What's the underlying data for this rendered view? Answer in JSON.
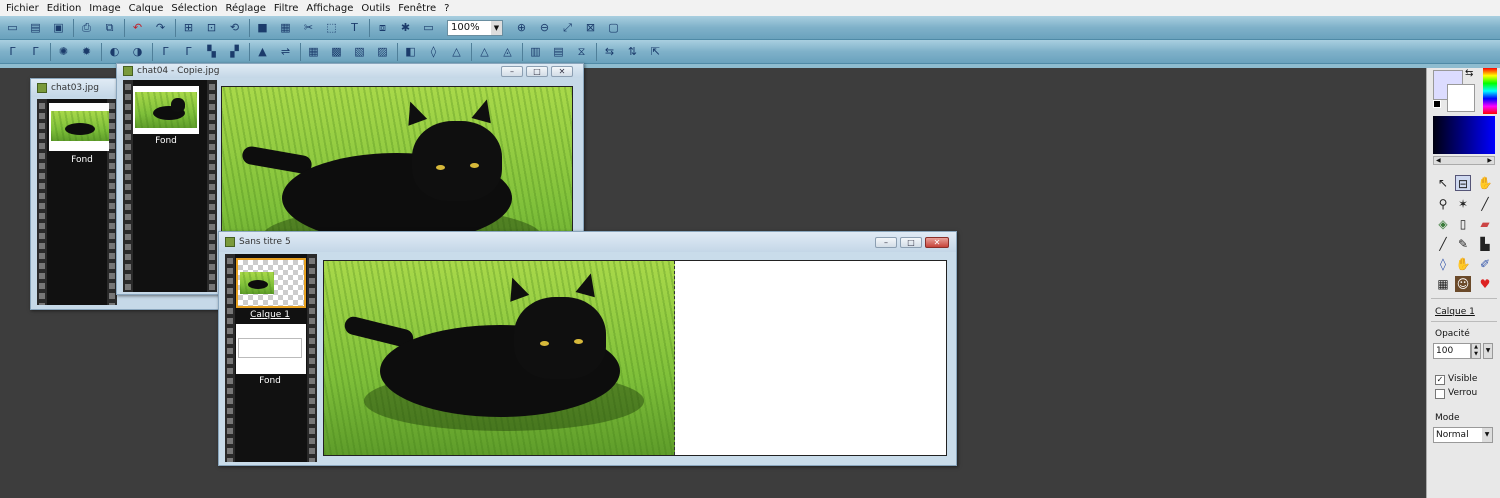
{
  "menu": [
    "Fichier",
    "Edition",
    "Image",
    "Calque",
    "Sélection",
    "Réglage",
    "Filtre",
    "Affichage",
    "Outils",
    "Fenêtre",
    "?"
  ],
  "toolbar": {
    "zoom_value": "100%",
    "row1_icons": [
      "new-icon",
      "open-icon",
      "save-icon",
      "print-icon",
      "scan-icon",
      "undo-icon",
      "redo-icon",
      "crop-icon",
      "resize-icon",
      "rotate-icon",
      "canvas-icon",
      "effect-icon",
      "cut-icon",
      "select-icon",
      "text-icon",
      "layer-icon",
      "stamp-icon",
      "frame-icon"
    ],
    "row2_icons": [
      "auto-level-icon",
      "auto-contrast-icon",
      "brightness-icon",
      "contrast-icon",
      "levels-icon",
      "curves-icon",
      "gamma-icon",
      "gamma2-icon",
      "rgb-icon",
      "hue-icon",
      "histogram-icon",
      "balance-icon",
      "sharpen-icon",
      "blur-icon",
      "smooth-icon",
      "noise-icon",
      "drop-icon",
      "drop2-icon",
      "triangle-icon",
      "triangle2-icon",
      "palette-icon",
      "monitor-icon",
      "grid-icon",
      "clip-icon",
      "flip-icon",
      "mirror-icon",
      "export-icon"
    ]
  },
  "windows": {
    "back": {
      "title": "chat03.jpg",
      "layer_label": "Fond"
    },
    "middle": {
      "title": "chat04 - Copie.jpg",
      "layer_label": "Fond"
    },
    "front": {
      "title": "Sans titre 5",
      "layer1_label": "Calque 1",
      "layer2_label": "Fond"
    }
  },
  "panel": {
    "layer_name": "Calque 1",
    "opacity_label": "Opacité",
    "opacity_value": "100",
    "visible_label": "Visible",
    "visible_checked": "✓",
    "lock_label": "Verrou",
    "mode_label": "Mode",
    "mode_value": "Normal",
    "tools": [
      "pointer-icon",
      "select-rect-icon",
      "hand-icon",
      "eyedropper-icon",
      "magic-wand-icon",
      "line-icon",
      "fill-icon",
      "spray-icon",
      "eraser-icon",
      "brush-icon",
      "pen-icon",
      "stamp-tool-icon",
      "drop-tool-icon",
      "smudge-icon",
      "clone-icon",
      "grid-tool-icon",
      "portrait-icon",
      "strawberry-icon"
    ]
  },
  "colors": {
    "primary": "#dcdcff",
    "accent": "#e6a020"
  }
}
